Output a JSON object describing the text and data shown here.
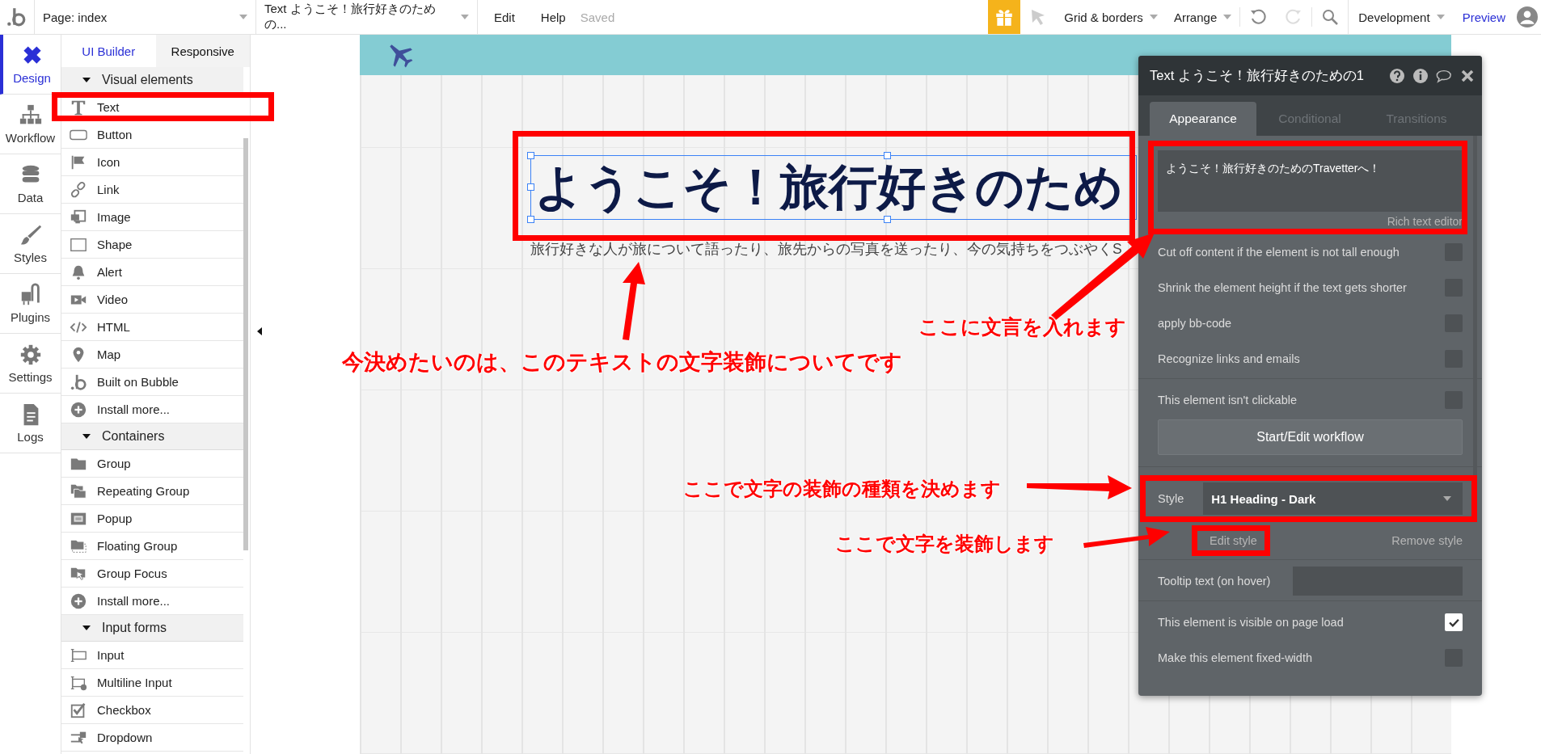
{
  "top_bar": {
    "page_selector": "Page: index",
    "element_selector": "Text ようこそ！旅行好きのための...",
    "menu": [
      "Edit",
      "Help"
    ],
    "status": "Saved",
    "grid": "Grid & borders",
    "arrange": "Arrange",
    "environment": "Development",
    "preview": "Preview"
  },
  "left_nav": [
    {
      "label": "Design",
      "selected": true
    },
    {
      "label": "Workflow",
      "selected": false
    },
    {
      "label": "Data",
      "selected": false
    },
    {
      "label": "Styles",
      "selected": false
    },
    {
      "label": "Plugins",
      "selected": false
    },
    {
      "label": "Settings",
      "selected": false
    },
    {
      "label": "Logs",
      "selected": false
    }
  ],
  "palette_tabs": [
    {
      "label": "UI Builder",
      "selected": true
    },
    {
      "label": "Responsive",
      "selected": false
    }
  ],
  "palette_sections": [
    {
      "title": "Visual elements",
      "expanded": true,
      "items": [
        "Text",
        "Button",
        "Icon",
        "Link",
        "Image",
        "Shape",
        "Alert",
        "Video",
        "HTML",
        "Map",
        "Built on Bubble",
        "Install more..."
      ]
    },
    {
      "title": "Containers",
      "expanded": true,
      "items": [
        "Group",
        "Repeating Group",
        "Popup",
        "Floating Group",
        "Group Focus",
        "Install more..."
      ]
    },
    {
      "title": "Input forms",
      "expanded": true,
      "items": [
        "Input",
        "Multiline Input",
        "Checkbox",
        "Dropdown"
      ]
    }
  ],
  "canvas": {
    "heading": "ようこそ！旅行好きのため",
    "subtitle": "旅行好きな人が旅について語ったり、旅先からの写真を送ったり、今の気持ちをつぶやくS"
  },
  "property_panel": {
    "title": "Text ようこそ！旅行好きのための1",
    "tabs": [
      {
        "label": "Appearance",
        "selected": true
      },
      {
        "label": "Conditional",
        "selected": false
      },
      {
        "label": "Transitions",
        "selected": false
      }
    ],
    "text_value": "ようこそ！旅行好きのためのTravetterへ！",
    "rich_text_link": "Rich text editor",
    "options": [
      {
        "label": "Cut off content if the element is not tall enough",
        "checked": false
      },
      {
        "label": "Shrink the element height if the text gets shorter",
        "checked": false
      },
      {
        "label": "apply bb-code",
        "checked": false
      },
      {
        "label": "Recognize links and emails",
        "checked": false
      }
    ],
    "clickable_option": {
      "label": "This element isn't clickable",
      "checked": false
    },
    "workflow_button": "Start/Edit workflow",
    "style_label": "Style",
    "style_value": "H1 Heading - Dark",
    "edit_style": "Edit style",
    "remove_style": "Remove style",
    "tooltip_label": "Tooltip text (on hover)",
    "layout_options": [
      {
        "label": "This element is visible on page load",
        "checked": true
      },
      {
        "label": "Make this element fixed-width",
        "checked": false
      }
    ]
  },
  "annotations": [
    "今決めたいのは、このテキストの文字装飾についてです",
    "ここに文言を入れます",
    "ここで文字の装飾の種類を決めます",
    "ここで文字を装飾します"
  ]
}
